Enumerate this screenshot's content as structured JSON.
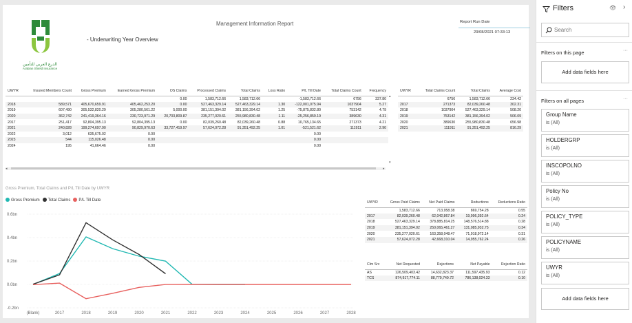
{
  "header": {
    "title": "Management Information Report",
    "subtitle": "- Underwriting Year Overview",
    "run_date_label": "Report Run Date",
    "run_date_value": "29/08/2021 07:33:13"
  },
  "logo": {
    "arabic_text": "الدرع العربي للتأمين",
    "english_text": "Arabian Shield Insurance",
    "colors": {
      "green": "#2e8b3a",
      "lime": "#8cc63f"
    }
  },
  "main_table": {
    "headers": [
      "UWYR",
      "Insured Members Count",
      "Gross Premium",
      "Earned Gross Premium",
      "OS Claims",
      "Processed Claims",
      "Total Claims",
      "Loss Ratio",
      "P/L Till Date",
      "Total Claims Count",
      "Frequency"
    ],
    "rows": [
      [
        "",
        "",
        "",
        "",
        "0.00",
        "1,583,712.66",
        "1,583,712.66",
        "",
        "-1,583,712.66",
        "6756",
        "337.80"
      ],
      [
        "2018",
        "589,571",
        "405,670,659.91",
        "405,462,253.20",
        "0.00",
        "527,463,329.14",
        "527,463,329.14",
        "1.30",
        "-122,001,075.94",
        "1037904",
        "5.27"
      ],
      [
        "2019",
        "607,490",
        "305,532,820.29",
        "305,280,561.22",
        "5,000.00",
        "381,151,394.02",
        "381,156,394.02",
        "1.25",
        "-75,875,832.80",
        "753142",
        "4.79"
      ],
      [
        "2020",
        "362,742",
        "241,419,364.16",
        "230,723,971.29",
        "20,703,809.87",
        "235,277,020.61",
        "255,980,830.48",
        "1.11",
        "-25,256,859.19",
        "389630",
        "4.31"
      ],
      [
        "2017",
        "251,417",
        "92,804,395.13",
        "92,804,395.13",
        "0.00",
        "82,039,260.48",
        "82,039,260.48",
        "0.88",
        "10,765,134.65",
        "271373",
        "4.21"
      ],
      [
        "2021",
        "240,828",
        "199,274,697.90",
        "90,829,970.63",
        "33,727,419.97",
        "57,624,072.28",
        "91,351,492.25",
        "1.01",
        "-521,521.62",
        "111911",
        "2.90"
      ],
      [
        "2022",
        "3,012",
        "635,675.02",
        "0.00",
        "",
        "",
        "",
        "",
        "0.00",
        "",
        ""
      ],
      [
        "2023",
        "544",
        "115,026.48",
        "0.00",
        "",
        "",
        "",
        "",
        "0.00",
        "",
        ""
      ],
      [
        "2024",
        "195",
        "41,664.46",
        "0.00",
        "",
        "",
        "",
        "",
        "0.00",
        "",
        ""
      ]
    ]
  },
  "cost_table": {
    "headers": [
      "UWYR",
      "Total Claims Count",
      "Total Claims",
      "Average Cost"
    ],
    "rows": [
      [
        "",
        "6756",
        "1,583,712.66",
        "234.42"
      ],
      [
        "2017",
        "271373",
        "82,039,260.48",
        "302.31"
      ],
      [
        "2018",
        "1037904",
        "527,463,329.14",
        "508.20"
      ],
      [
        "2019",
        "753142",
        "381,156,394.02",
        "506.09"
      ],
      [
        "2020",
        "389630",
        "255,980,830.48",
        "656.98"
      ],
      [
        "2021",
        "111911",
        "91,351,492.25",
        "816.29"
      ]
    ]
  },
  "reductions_table": {
    "headers": [
      "UWYR",
      "Gross Paid Claims",
      "Net Paid Claims",
      "Reductions",
      "Reductions Ratio"
    ],
    "rows": [
      [
        "",
        "1,583,712.66",
        "713,958.38",
        "869,754.28",
        "0.55"
      ],
      [
        "2017",
        "82,039,260.48",
        "62,042,867.84",
        "19,996,392.64",
        "0.24"
      ],
      [
        "2018",
        "527,463,329.14",
        "378,885,814.25",
        "148,576,514.88",
        "0.28"
      ],
      [
        "2019",
        "381,151,394.02",
        "250,065,461.27",
        "131,085,932.75",
        "0.34"
      ],
      [
        "2020",
        "235,277,020.61",
        "163,358,048.47",
        "71,918,972.14",
        "0.31"
      ],
      [
        "2021",
        "57,624,072.28",
        "42,668,310.04",
        "14,955,762.24",
        "0.26"
      ]
    ]
  },
  "rejection_table": {
    "headers": [
      "Clm Src",
      "Net Requested",
      "Rejections",
      "Net Payable",
      "Rejection Ratio"
    ],
    "rows": [
      [
        "AS",
        "126,509,403.42",
        "14,632,823.37",
        "111,597,435.93",
        "0.12"
      ],
      [
        "TCS",
        "874,917,774.11",
        "88,779,749.72",
        "786,138,024.33",
        "0.10"
      ]
    ]
  },
  "chart_data": {
    "type": "line",
    "title": "Gross Premium, Total Claims and P/L Till Date by UWYR",
    "categories": [
      "(Blank)",
      "2017",
      "2018",
      "2019",
      "2020",
      "2021",
      "2022",
      "2023",
      "2024",
      "2025",
      "2026",
      "2027",
      "2028"
    ],
    "ylim": [
      -0.2,
      0.6
    ],
    "yticks": [
      "-0.2bn",
      "0.0bn",
      "0.2bn",
      "0.4bn",
      "0.6bn"
    ],
    "series": [
      {
        "name": "Gross Premium",
        "color": "#20b8b2",
        "values": [
          0,
          0.093,
          0.406,
          0.306,
          0.241,
          0.199,
          0.001,
          0.0001,
          4e-05,
          null,
          null,
          null,
          null
        ]
      },
      {
        "name": "Total Claims",
        "color": "#323232",
        "values": [
          0.0016,
          0.082,
          0.527,
          0.381,
          0.256,
          0.091,
          null,
          null,
          null,
          null,
          null,
          null,
          null
        ]
      },
      {
        "name": "P/L Till Date",
        "color": "#e8605e",
        "values": [
          -0.0016,
          0.011,
          -0.122,
          -0.076,
          -0.025,
          -0.0005,
          0,
          0,
          0,
          0,
          0,
          0,
          0
        ]
      }
    ],
    "legend_position": "top-left",
    "grid": true
  },
  "filters_pane": {
    "title": "Filters",
    "search_placeholder": "Search",
    "on_this_page": "Filters on this page",
    "on_all_pages": "Filters on all pages",
    "add_data": "Add data fields here",
    "cards": [
      {
        "name": "Group Name",
        "value": "is (All)"
      },
      {
        "name": "HOLDERGRP",
        "value": "is (All)"
      },
      {
        "name": "INSCOPOLNO",
        "value": "is (All)"
      },
      {
        "name": "Policy No",
        "value": "is (All)"
      },
      {
        "name": "POLICY_TYPE",
        "value": "is (All)"
      },
      {
        "name": "POLICYNAME",
        "value": "is (All)"
      },
      {
        "name": "UWYR",
        "value": "is (All)"
      }
    ]
  }
}
